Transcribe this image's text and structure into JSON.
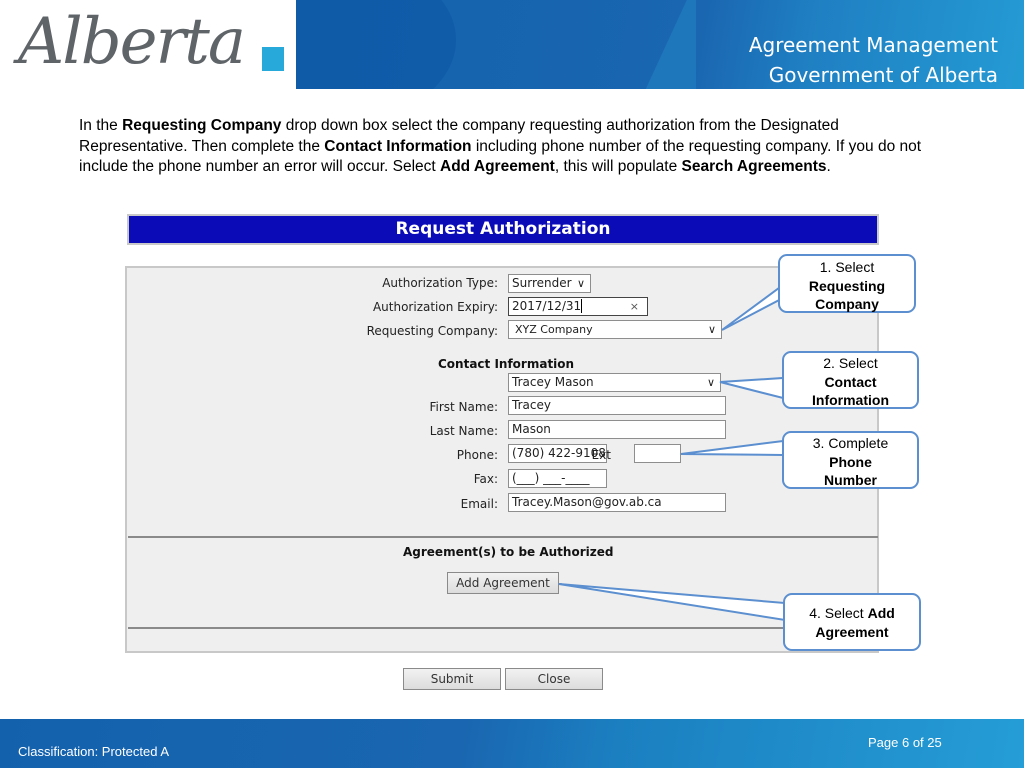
{
  "header": {
    "logo_text": "Alberta",
    "title_line1": "Agreement Management",
    "title_line2": "Government of Alberta"
  },
  "instructions": {
    "p1": "In the ",
    "b1": "Requesting Company",
    "p2": " drop down box select the company requesting authorization from the Designated Representative.  Then complete the ",
    "b2": "Contact Information",
    "p3": " including phone number of the requesting company.  If you do not include the phone number an error will occur.  Select ",
    "b3": "Add Agreement",
    "p4": ", this will populate ",
    "b4": "Search Agreements",
    "p5": "."
  },
  "form": {
    "title": "Request Authorization",
    "authorization_type": {
      "label": "Authorization Type:",
      "value": "Surrender"
    },
    "authorization_expiry": {
      "label": "Authorization Expiry:",
      "value": "2017/12/31"
    },
    "requesting_company": {
      "label": "Requesting Company:",
      "value": "XYZ Company"
    },
    "contact_section": "Contact Information",
    "contact_select": {
      "value": "Tracey Mason"
    },
    "first_name": {
      "label": "First Name:",
      "value": "Tracey"
    },
    "last_name": {
      "label": "Last Name:",
      "value": "Mason"
    },
    "phone": {
      "label": "Phone:",
      "value": "(780) 422-9108",
      "ext_label": "Ext",
      "ext_value": ""
    },
    "fax": {
      "label": "Fax:",
      "value": "(___) ___-____"
    },
    "email": {
      "label": "Email:",
      "value": "Tracey.Mason@gov.ab.ca"
    },
    "agreements_section": "Agreement(s) to be Authorized",
    "add_agreement_label": "Add Agreement",
    "submit_label": "Submit",
    "close_label": "Close"
  },
  "callouts": [
    {
      "line1": "1. Select",
      "bold": "Requesting Company"
    },
    {
      "line1": "2. Select",
      "bold": "Contact Information"
    },
    {
      "line1": "3. Complete",
      "bold": "Phone Number"
    },
    {
      "line1": "4. Select ",
      "bold": "Add Agreement"
    }
  ],
  "icons": {
    "chevron": "⌵",
    "clear": "×"
  },
  "footer": {
    "classification": "Classification: Protected A",
    "page": "Page 6 of 25"
  },
  "colors": {
    "form_title_bar": "#0b0bb8",
    "callout_border": "#5b8fcf",
    "header_blue": "#1a66b0",
    "logo_accent": "#27a9d9"
  }
}
